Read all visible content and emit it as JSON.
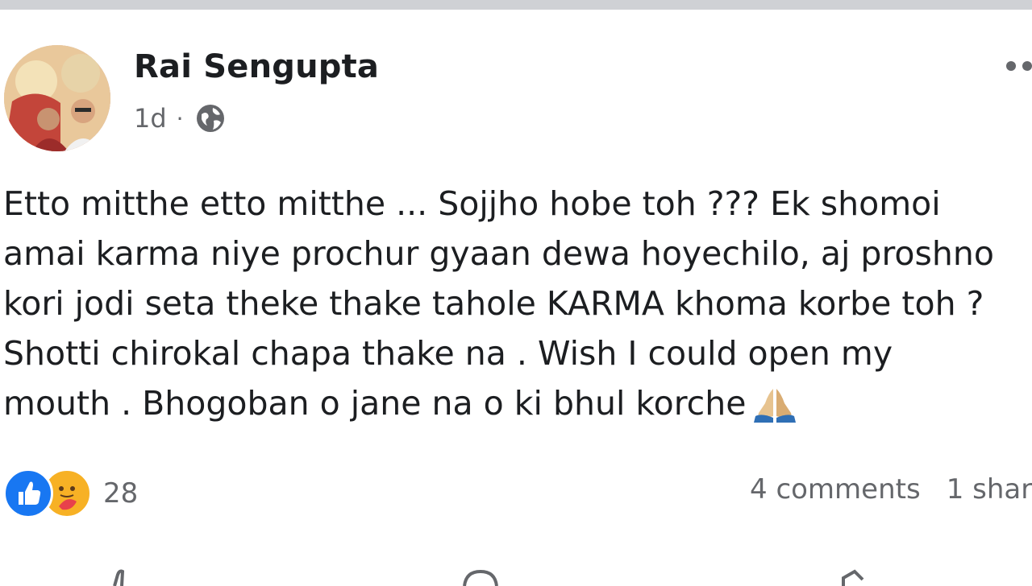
{
  "post": {
    "author": "Rai Sengupta",
    "time": "1d",
    "separator": "·",
    "privacy_icon": "globe-icon",
    "more_icon": "more-horizontal-icon",
    "text_lines": [
      "Etto mitthe etto mitthe ... Sojjho hobe toh ??? Ek shomoi",
      "amai karma niye prochur gyaan dewa hoyechilo, aj proshno",
      "kori jodi seta theke thake tahole KARMA khoma korbe toh ?",
      "Shotti chirokal chapa thake na . Wish I could open my",
      "mouth . Bhogoban o jane na o ki bhul korche"
    ],
    "trailing_emoji": "folded-hands-icon"
  },
  "reactions": {
    "icons": [
      "like-icon",
      "care-icon"
    ],
    "count": "28"
  },
  "engagement": {
    "comments": "4 comments",
    "shares": "1 shar"
  },
  "action_bar": {
    "icons": [
      "like-outline-icon",
      "comment-outline-icon",
      "share-outline-icon"
    ]
  },
  "colors": {
    "like_blue": "#1877f2",
    "care_yellow": "#f7b125",
    "secondary_text": "#65676b",
    "primary_text": "#1c1e21"
  }
}
